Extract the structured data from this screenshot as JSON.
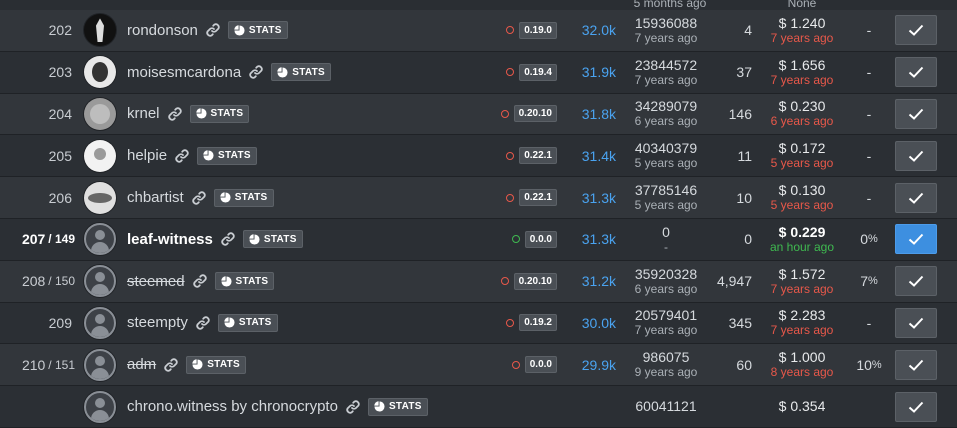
{
  "header_partial": {
    "block_ago": "5 months ago",
    "price": "None"
  },
  "rows": [
    {
      "rank": "202",
      "rank_sub": "",
      "avatar": "dark",
      "name": "rondonson",
      "stats": "STATS",
      "version": "0.19.0",
      "dot": "red",
      "votes": "32.0k",
      "block": "15936088",
      "block_ago": "7 years ago",
      "missed": "4",
      "price": "$ 1.240",
      "price_ago": "7 years ago",
      "price_ago_color": "red",
      "pct": "-",
      "voted": false,
      "bold": false,
      "strike": false
    },
    {
      "rank": "203",
      "rank_sub": "",
      "avatar": "face",
      "name": "moisesmcardona",
      "stats": "STATS",
      "version": "0.19.4",
      "dot": "red",
      "votes": "31.9k",
      "block": "23844572",
      "block_ago": "7 years ago",
      "missed": "37",
      "price": "$ 1.656",
      "price_ago": "7 years ago",
      "price_ago_color": "red",
      "pct": "-",
      "voted": false,
      "bold": false,
      "strike": false
    },
    {
      "rank": "204",
      "rank_sub": "",
      "avatar": "grey",
      "name": "krnel",
      "stats": "STATS",
      "version": "0.20.10",
      "dot": "red",
      "votes": "31.8k",
      "block": "34289079",
      "block_ago": "6 years ago",
      "missed": "146",
      "price": "$ 0.230",
      "price_ago": "6 years ago",
      "price_ago_color": "red",
      "pct": "-",
      "voted": false,
      "bold": false,
      "strike": false
    },
    {
      "rank": "205",
      "rank_sub": "",
      "avatar": "white",
      "name": "helpie",
      "stats": "STATS",
      "version": "0.22.1",
      "dot": "red",
      "votes": "31.4k",
      "block": "40340379",
      "block_ago": "5 years ago",
      "missed": "11",
      "price": "$ 0.172",
      "price_ago": "5 years ago",
      "price_ago_color": "red",
      "pct": "-",
      "voted": false,
      "bold": false,
      "strike": false
    },
    {
      "rank": "206",
      "rank_sub": "",
      "avatar": "eye",
      "name": "chbartist",
      "stats": "STATS",
      "version": "0.22.1",
      "dot": "red",
      "votes": "31.3k",
      "block": "37785146",
      "block_ago": "5 years ago",
      "missed": "10",
      "price": "$ 0.130",
      "price_ago": "5 years ago",
      "price_ago_color": "red",
      "pct": "-",
      "voted": false,
      "bold": false,
      "strike": false
    },
    {
      "rank": "207",
      "rank_sub": "/ 149",
      "avatar": "default",
      "name": "leaf-witness",
      "stats": "STATS",
      "version": "0.0.0",
      "dot": "green",
      "votes": "31.3k",
      "block": "0",
      "block_ago": "-",
      "missed": "0",
      "price": "$ 0.229",
      "price_ago": "an hour ago",
      "price_ago_color": "green",
      "pct": "0",
      "pct_unit": "%",
      "voted": true,
      "bold": true,
      "strike": false
    },
    {
      "rank": "208",
      "rank_sub": "/ 150",
      "avatar": "default",
      "name": "steemed",
      "stats": "STATS",
      "version": "0.20.10",
      "dot": "red",
      "votes": "31.2k",
      "block": "35920328",
      "block_ago": "6 years ago",
      "missed": "4,947",
      "price": "$ 1.572",
      "price_ago": "7 years ago",
      "price_ago_color": "red",
      "pct": "7",
      "pct_unit": "%",
      "voted": false,
      "bold": false,
      "strike": true
    },
    {
      "rank": "209",
      "rank_sub": "",
      "avatar": "default",
      "name": "steempty",
      "stats": "STATS",
      "version": "0.19.2",
      "dot": "red",
      "votes": "30.0k",
      "block": "20579401",
      "block_ago": "7 years ago",
      "missed": "345",
      "price": "$ 2.283",
      "price_ago": "7 years ago",
      "price_ago_color": "red",
      "pct": "-",
      "voted": false,
      "bold": false,
      "strike": false
    },
    {
      "rank": "210",
      "rank_sub": "/ 151",
      "avatar": "default",
      "name": "adm",
      "stats": "STATS",
      "version": "0.0.0",
      "dot": "red",
      "votes": "29.9k",
      "block": "986075",
      "block_ago": "9 years ago",
      "missed": "60",
      "price": "$ 1.000",
      "price_ago": "8 years ago",
      "price_ago_color": "red",
      "pct": "10",
      "pct_unit": "%",
      "voted": false,
      "bold": false,
      "strike": true
    },
    {
      "rank": "",
      "rank_sub": "",
      "avatar": "default",
      "name": "chrono.witness by chronocrypto",
      "stats": "STATS",
      "version": "",
      "dot": "",
      "votes": "",
      "block": "60041121",
      "block_ago": "",
      "missed": "",
      "price": "$ 0.354",
      "price_ago": "",
      "price_ago_color": "red",
      "pct": "",
      "voted": false,
      "bold": false,
      "strike": false
    }
  ],
  "colors": {
    "accent": "#3d8fe0",
    "red": "#e8584a",
    "green": "#3fb950",
    "link": "#4aa3f0"
  },
  "icons": {
    "link": "link-icon",
    "stats": "pie-chart-icon",
    "check": "checkmark-icon"
  }
}
